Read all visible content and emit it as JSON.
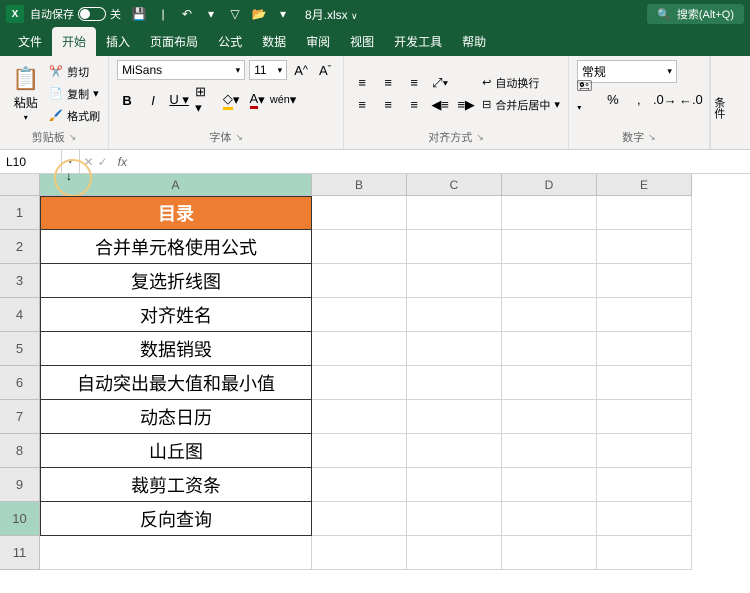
{
  "titlebar": {
    "app_icon_text": "X",
    "autosave_label": "自动保存",
    "autosave_state": "关",
    "filename": "8月.xlsx",
    "search_placeholder": "搜索(Alt+Q)"
  },
  "tabs": {
    "items": [
      "文件",
      "开始",
      "插入",
      "页面布局",
      "公式",
      "数据",
      "审阅",
      "视图",
      "开发工具",
      "帮助"
    ],
    "active_index": 1
  },
  "ribbon": {
    "paste": {
      "label": "粘贴",
      "cut": "剪切",
      "copy": "复制",
      "format_painter": "格式刷",
      "group_label": "剪贴板"
    },
    "font": {
      "name": "MiSans",
      "size": "11",
      "group_label": "字体"
    },
    "align": {
      "wrap": "自动换行",
      "merge": "合并后居中",
      "group_label": "对齐方式"
    },
    "number": {
      "format": "常规",
      "group_label": "数字"
    },
    "styles": {
      "conditional": "条件"
    }
  },
  "formulabar": {
    "namebox": "L10",
    "formula": ""
  },
  "columns": [
    "A",
    "B",
    "C",
    "D",
    "E"
  ],
  "rows": [
    "1",
    "2",
    "3",
    "4",
    "5",
    "6",
    "7",
    "8",
    "9",
    "10",
    "11"
  ],
  "cells_A": [
    "目录",
    "合并单元格使用公式",
    "复选折线图",
    "对齐姓名",
    "数据销毁",
    "自动突出最大值和最小值",
    "动态日历",
    "山丘图",
    "裁剪工资条",
    "反向查询"
  ],
  "selected_row": 10
}
